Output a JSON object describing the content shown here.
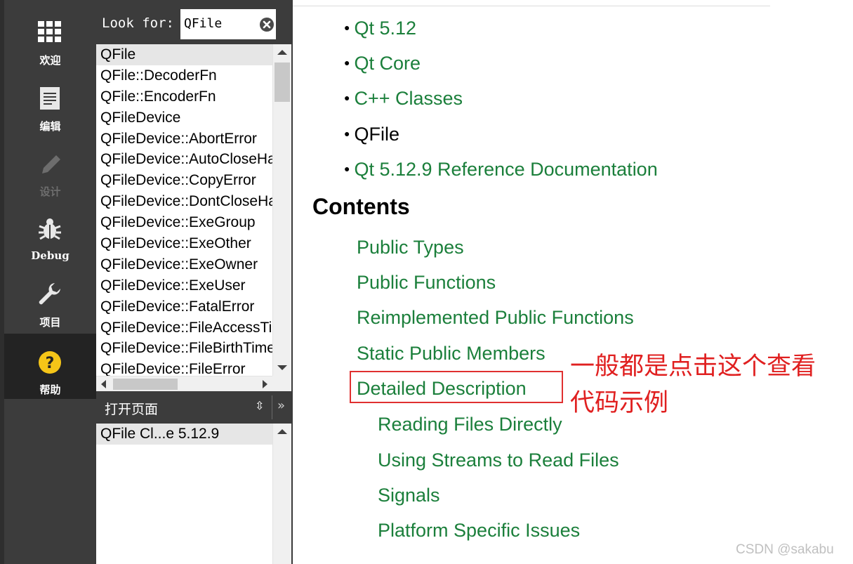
{
  "modebar": {
    "items": [
      {
        "label": "欢迎",
        "icon": "grid-icon"
      },
      {
        "label": "编辑",
        "icon": "document-icon"
      },
      {
        "label": "设计",
        "icon": "pencil-icon"
      },
      {
        "label": "Debug",
        "icon": "bug-icon"
      },
      {
        "label": "项目",
        "icon": "wrench-icon"
      },
      {
        "label": "帮助",
        "icon": "help-icon"
      }
    ],
    "active": "帮助"
  },
  "index": {
    "look_for_label": "Look for:",
    "search_value": "QFile",
    "items": [
      "QFile",
      "QFile::DecoderFn",
      "QFile::EncoderFn",
      "QFileDevice",
      "QFileDevice::AbortError",
      "QFileDevice::AutoCloseHandle",
      "QFileDevice::CopyError",
      "QFileDevice::DontCloseHandle",
      "QFileDevice::ExeGroup",
      "QFileDevice::ExeOther",
      "QFileDevice::ExeOwner",
      "QFileDevice::ExeUser",
      "QFileDevice::FatalError",
      "QFileDevice::FileAccessTime",
      "QFileDevice::FileBirthTime",
      "QFileDevice::FileError"
    ],
    "selected": "QFile"
  },
  "open_pages": {
    "title": "打开页面",
    "items": [
      "QFile Cl...e 5.12.9"
    ]
  },
  "doc": {
    "breadcrumbs": [
      {
        "text": "Qt 5.12",
        "link": true
      },
      {
        "text": "Qt Core",
        "link": true
      },
      {
        "text": "C++ Classes",
        "link": true
      },
      {
        "text": "QFile",
        "link": false
      },
      {
        "text": "Qt 5.12.9 Reference Documentation",
        "link": true
      }
    ],
    "contents_heading": "Contents",
    "toc": [
      {
        "text": "Public Types",
        "level": 1
      },
      {
        "text": "Public Functions",
        "level": 1
      },
      {
        "text": "Reimplemented Public Functions",
        "level": 1
      },
      {
        "text": "Static Public Members",
        "level": 1
      },
      {
        "text": "Detailed Description",
        "level": 1
      },
      {
        "text": "Reading Files Directly",
        "level": 2
      },
      {
        "text": "Using Streams to Read Files",
        "level": 2
      },
      {
        "text": "Signals",
        "level": 2
      },
      {
        "text": "Platform Specific Issues",
        "level": 2
      }
    ]
  },
  "annotation": {
    "line1": "一般都是点击这个查看",
    "line2": "代码示例"
  },
  "watermark": "CSDN @sakabu",
  "colors": {
    "link": "#1b7f3b",
    "sidebar": "#3c3c3c",
    "annotation": "#e02020",
    "help_icon": "#f5c518"
  }
}
